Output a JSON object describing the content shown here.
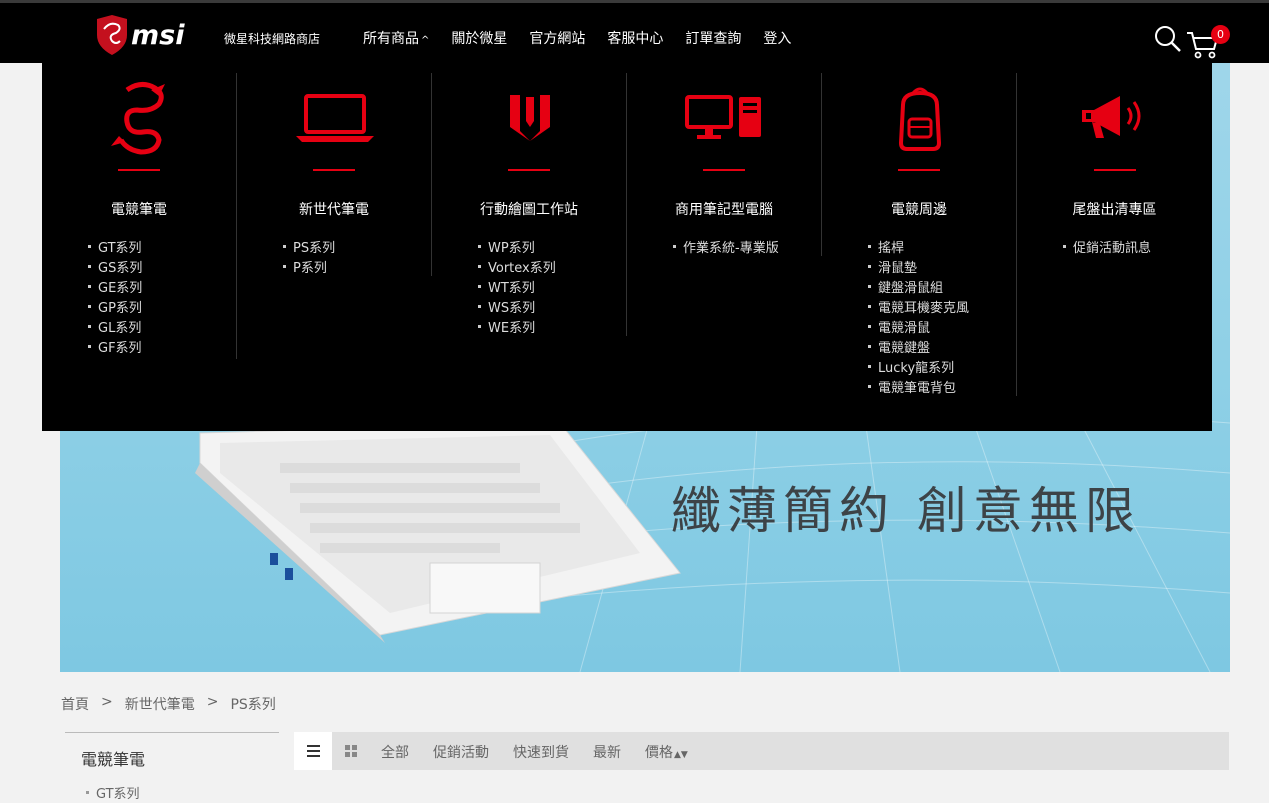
{
  "header": {
    "brand": "msi",
    "store_name": "微星科技網路商店",
    "nav": [
      "所有商品",
      "關於微星",
      "官方網站",
      "客服中心",
      "訂單查詢",
      "登入"
    ],
    "cart_count": "0"
  },
  "banner": {
    "slogan": "纖薄簡約 創意無限"
  },
  "mega_menu": {
    "columns": [
      {
        "title": "電競筆電",
        "icon": "dragon-icon",
        "items": [
          "GT系列",
          "GS系列",
          "GE系列",
          "GP系列",
          "GL系列",
          "GF系列"
        ]
      },
      {
        "title": "新世代筆電",
        "icon": "laptop-icon",
        "items": [
          "PS系列",
          "P系列"
        ]
      },
      {
        "title": "行動繪圖工作站",
        "icon": "workstation-icon",
        "items": [
          "WP系列",
          "Vortex系列",
          "WT系列",
          "WS系列",
          "WE系列"
        ]
      },
      {
        "title": "商用筆記型電腦",
        "icon": "desktop-pc-icon",
        "items": [
          "作業系統-專業版"
        ]
      },
      {
        "title": "電競周邊",
        "icon": "backpack-icon",
        "items": [
          "搖桿",
          "滑鼠墊",
          "鍵盤滑鼠組",
          "電競耳機麥克風",
          "電競滑鼠",
          "電競鍵盤",
          "Lucky龍系列",
          "電競筆電背包"
        ]
      },
      {
        "title": "尾盤出清專區",
        "icon": "megaphone-icon",
        "items": [
          "促銷活動訊息"
        ]
      }
    ]
  },
  "breadcrumb": [
    "首頁",
    "新世代筆電",
    "PS系列"
  ],
  "sidebar": {
    "title": "電競筆電",
    "items": [
      "GT系列"
    ]
  },
  "toolbar": {
    "filters": [
      "全部",
      "促銷活動",
      "快速到貨",
      "最新",
      "價格"
    ]
  },
  "colors": {
    "accent": "#e60012",
    "header_bg": "#000000",
    "banner_bg": "#8fd0e6"
  }
}
